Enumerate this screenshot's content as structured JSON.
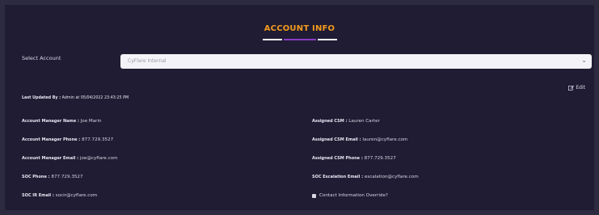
{
  "header": {
    "title": "ACCOUNT INFO"
  },
  "account_select": {
    "label": "Select Account",
    "value": "CyFlare Internal"
  },
  "edit_label": "Edit",
  "last_updated": {
    "label": "Last Updated By :",
    "value": "Admin at 05/04/2022 23:43:25 PM"
  },
  "fields": {
    "account_manager_name": {
      "label": "Account Manager Name :",
      "value": "Joe Marin"
    },
    "account_manager_phone": {
      "label": "Account Manager Phone :",
      "value": "877.729.3527"
    },
    "account_manager_email": {
      "label": "Account Manager Email :",
      "value": "joe@cyflare.com"
    },
    "soc_phone": {
      "label": "SOC Phone :",
      "value": "877.729.3527"
    },
    "soc_ir_email": {
      "label": "SOC IR Email :",
      "value": "socir@cyflare.com"
    },
    "assigned_csm": {
      "label": "Assigned CSM :",
      "value": "Lauren Carter"
    },
    "assigned_csm_email": {
      "label": "Assigned CSM Email :",
      "value": "lauren@cyflare.com"
    },
    "assigned_csm_phone": {
      "label": "Assigned CSM Phone :",
      "value": "877.729.3527"
    },
    "soc_escalation_email": {
      "label": "SOC Escalation Email :",
      "value": "escalation@cyflare.com"
    }
  },
  "contact_override": {
    "label": "Contact Information Override?",
    "checked": false
  },
  "colors": {
    "accent": "#f39a1d",
    "panel": "#1f1c33",
    "underline_mid": "#8a3cc7"
  },
  "icons": {
    "edit": "edit-pencil-icon",
    "chevron": "chevron-down-icon"
  }
}
